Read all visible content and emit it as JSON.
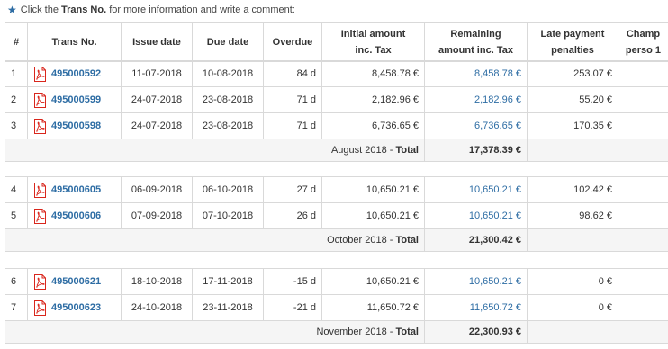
{
  "hint": {
    "prefix": "Click the",
    "bold": "Trans No.",
    "suffix": "for more information and write a comment:"
  },
  "columns": {
    "num": "#",
    "trans": "Trans No.",
    "issue": "Issue date",
    "due": "Due date",
    "overdue": "Overdue",
    "initial_1": "Initial amount",
    "initial_2": "inc. Tax",
    "remaining_1": "Remaining",
    "remaining_2": "amount inc. Tax",
    "late_1": "Late payment",
    "late_2": "penalties",
    "champ_1": "Champ",
    "champ_2": "perso 1"
  },
  "groups": [
    {
      "rows": [
        {
          "num": "1",
          "trans": "495000592",
          "issue": "11-07-2018",
          "due": "10-08-2018",
          "overdue": "84 d",
          "initial": "8,458.78 €",
          "remaining": "8,458.78 €",
          "late": "253.07 €",
          "champ": ""
        },
        {
          "num": "2",
          "trans": "495000599",
          "issue": "24-07-2018",
          "due": "23-08-2018",
          "overdue": "71 d",
          "initial": "2,182.96 €",
          "remaining": "2,182.96 €",
          "late": "55.20 €",
          "champ": ""
        },
        {
          "num": "3",
          "trans": "495000598",
          "issue": "24-07-2018",
          "due": "23-08-2018",
          "overdue": "71 d",
          "initial": "6,736.65 €",
          "remaining": "6,736.65 €",
          "late": "170.35 €",
          "champ": ""
        }
      ],
      "total_period": "August 2018",
      "total_word": "Total",
      "total_value": "17,378.39 €"
    },
    {
      "rows": [
        {
          "num": "4",
          "trans": "495000605",
          "issue": "06-09-2018",
          "due": "06-10-2018",
          "overdue": "27 d",
          "initial": "10,650.21 €",
          "remaining": "10,650.21 €",
          "late": "102.42 €",
          "champ": ""
        },
        {
          "num": "5",
          "trans": "495000606",
          "issue": "07-09-2018",
          "due": "07-10-2018",
          "overdue": "26 d",
          "initial": "10,650.21 €",
          "remaining": "10,650.21 €",
          "late": "98.62 €",
          "champ": ""
        }
      ],
      "total_period": "October 2018",
      "total_word": "Total",
      "total_value": "21,300.42 €"
    },
    {
      "rows": [
        {
          "num": "6",
          "trans": "495000621",
          "issue": "18-10-2018",
          "due": "17-11-2018",
          "overdue": "-15 d",
          "initial": "10,650.21 €",
          "remaining": "10,650.21 €",
          "late": "0 €",
          "champ": ""
        },
        {
          "num": "7",
          "trans": "495000623",
          "issue": "24-10-2018",
          "due": "23-11-2018",
          "overdue": "-21 d",
          "initial": "11,650.72 €",
          "remaining": "11,650.72 €",
          "late": "0 €",
          "champ": ""
        }
      ],
      "total_period": "November 2018",
      "total_word": "Total",
      "total_value": "22,300.93 €"
    }
  ],
  "total_separator": "-",
  "icons": {
    "star": "star-icon",
    "pdf": "pdf-icon"
  },
  "colors": {
    "link": "#2e6da4",
    "pdf_red": "#d9261c",
    "border": "#d9d9d9"
  }
}
